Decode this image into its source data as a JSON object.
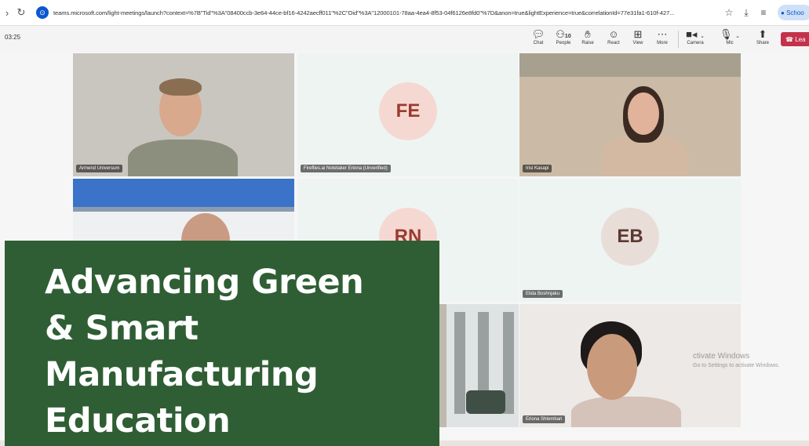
{
  "browser": {
    "url": "teams.microsoft.com/light-meetings/launch?context=%7B\"Tid\"%3A\"08400ccb-3e64-44ce-bf16-4242aecff011\"%2C\"Oid\"%3A\"12000101-78aa-4ea4-8f53-04f6126e8fd0\"%7D&anon=true&lightExperience=true&correlationId=77e31fa1-610f-427...",
    "profile_label": "Schoo"
  },
  "toolbar": {
    "timer": "03:25",
    "people_count": "10",
    "buttons": {
      "chat": "Chat",
      "people": "People",
      "raise": "Raise",
      "react": "React",
      "view": "View",
      "more": "More",
      "camera": "Camera",
      "mic": "Mic",
      "share": "Share",
      "leave": "Lea"
    }
  },
  "participants": [
    {
      "name": "Armend Universum",
      "initials": ""
    },
    {
      "name": "Fireflies.ai Notetaker Eriona (Unverified)",
      "initials": "FE"
    },
    {
      "name": "Irisi Kasapi",
      "initials": ""
    },
    {
      "name": "",
      "initials": ""
    },
    {
      "name": "",
      "initials": "RN"
    },
    {
      "name": "Elida Boshnjaku",
      "initials": "EB"
    },
    {
      "name": "",
      "initials": ""
    },
    {
      "name": "Eriona Shtembari",
      "initials": ""
    }
  ],
  "watermark": {
    "line1": "ctivate Windows",
    "line2": "Go to Settings to activate Windows."
  },
  "overlay": {
    "line1": "Advancing Green",
    "line2": "& Smart",
    "line3": "Manufacturing",
    "line4": "Education"
  },
  "colors": {
    "overlay_bg": "#2f5e34",
    "leave_bg": "#c4314b",
    "avatar_bg": "#f6d8d2"
  }
}
